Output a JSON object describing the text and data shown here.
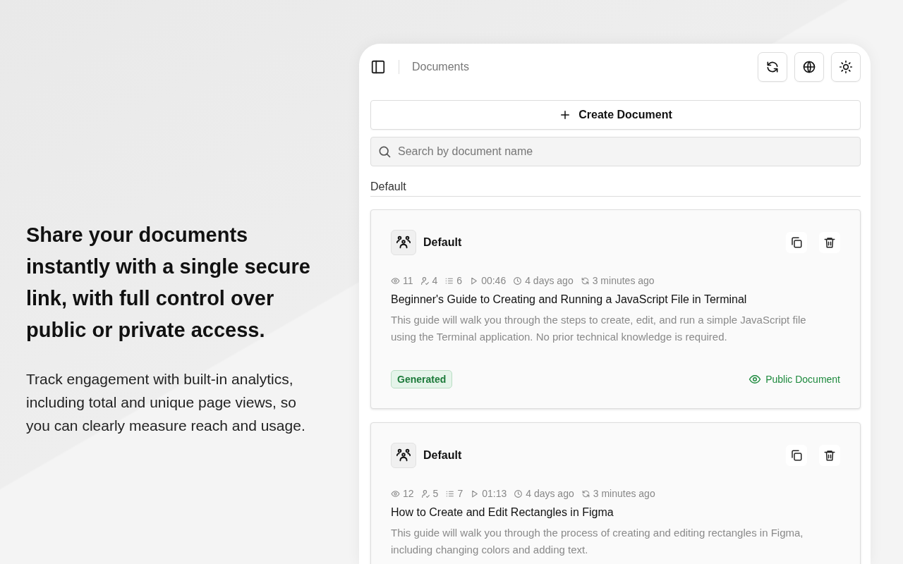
{
  "promo": {
    "headline": "Share your documents instantly with a single secure link, with full control over public or private access.",
    "body": "Track engagement with built-in analytics, including total and unique page views, so you can clearly measure reach and usage."
  },
  "panel": {
    "title": "Documents",
    "create_button": "Create Document",
    "search": {
      "placeholder": "Search by document name"
    },
    "section": "Default",
    "documents": [
      {
        "workspace": "Default",
        "metrics": [
          {
            "kind": "views",
            "text": "11"
          },
          {
            "kind": "visitors",
            "text": "4"
          },
          {
            "kind": "steps",
            "text": "6"
          },
          {
            "kind": "duration",
            "text": "00:46"
          },
          {
            "kind": "created",
            "text": "4 days ago"
          },
          {
            "kind": "updated",
            "text": "3 minutes ago"
          }
        ],
        "title": "Beginner's Guide to Creating and Running a JavaScript File in Terminal",
        "description": "This guide will walk you through the steps to create, edit, and run a simple JavaScript file using the Terminal application. No prior technical knowledge is required.",
        "badge": "Generated",
        "visibility": {
          "kind": "public",
          "text": "Public Document"
        }
      },
      {
        "workspace": "Default",
        "metrics": [
          {
            "kind": "views",
            "text": "12"
          },
          {
            "kind": "visitors",
            "text": "5"
          },
          {
            "kind": "steps",
            "text": "7"
          },
          {
            "kind": "duration",
            "text": "01:13"
          },
          {
            "kind": "created",
            "text": "4 days ago"
          },
          {
            "kind": "updated",
            "text": "3 minutes ago"
          }
        ],
        "title": "How to Create and Edit Rectangles in Figma",
        "description": "This guide will walk you through the process of creating and editing rectangles in Figma, including changing colors and adding text."
      }
    ]
  }
}
